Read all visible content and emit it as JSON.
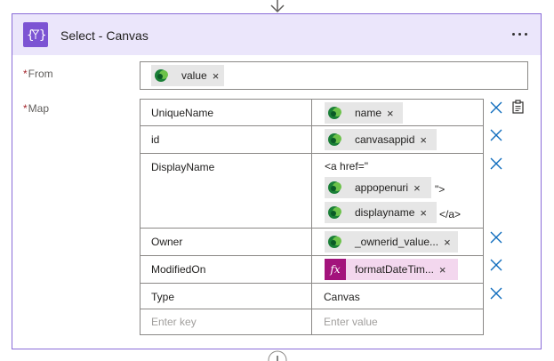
{
  "action": {
    "title": "Select - Canvas",
    "icon": "data-operation-icon",
    "more": "more-options-icon"
  },
  "from": {
    "label": "From",
    "token": {
      "label": "value",
      "icon": "dataverse-icon",
      "remove": "×"
    }
  },
  "map": {
    "label": "Map",
    "required_marker": "*",
    "rows": [
      {
        "key": "UniqueName",
        "value_token": "name"
      },
      {
        "key": "id",
        "value_token": "canvasappid"
      },
      {
        "key": "DisplayName",
        "prefix": "<a href=\"",
        "token1": "appopenuri",
        "middle": "\">",
        "token2": "displayname",
        "suffix": "</a>"
      },
      {
        "key": "Owner",
        "value_token": "_ownerid_value..."
      },
      {
        "key": "ModifiedOn",
        "value_token": "formatDateTim...",
        "token_type": "expression"
      },
      {
        "key": "Type",
        "value": "Canvas"
      }
    ],
    "new_row": {
      "key_placeholder": "Enter key",
      "value_placeholder": "Enter value"
    }
  },
  "token_remove": "×",
  "fx_label": "fx",
  "colors": {
    "header_bg": "#ebe6fb",
    "action_icon_bg": "#7c54d3",
    "border_accent": "#8a6cd8",
    "token_bg": "#e6e6e6",
    "fx_token_bg": "#f3d7ee",
    "fx_icon_bg": "#a3137c",
    "delete_icon": "#0f6cbd",
    "dataverse_green": "#1a7f37"
  }
}
